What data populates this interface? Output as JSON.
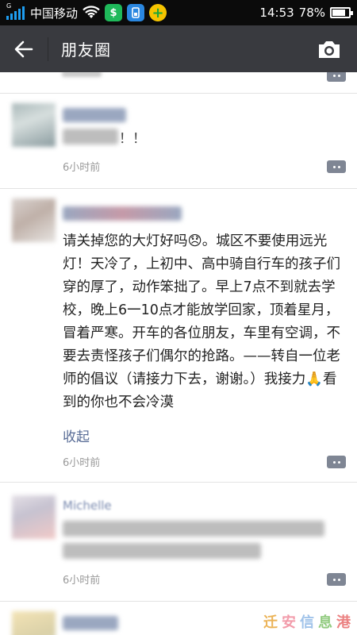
{
  "status_bar": {
    "carrier": "中国移动",
    "time": "14:53",
    "battery_percent": 78,
    "battery_label": "78%",
    "signal_type": "G"
  },
  "header": {
    "title": "朋友圈",
    "back_icon": "arrow-left-icon",
    "camera_icon": "camera-icon"
  },
  "feed": {
    "posts": [
      {
        "author": "",
        "text_suffix": "！！",
        "time": "6小时前"
      },
      {
        "author": "",
        "text": "请关掉您的大灯好吗😞。城区不要使用远光灯！天冷了，上初中、高中骑自行车的孩子们穿的厚了，动作笨拙了。早上7点不到就去学校，晚上6一10点才能放学回家，顶着星月，冒着严寒。开车的各位朋友，车里有空调，不要去责怪孩子们偶尔的抢路。——转自一位老师的倡议（请接力下去，谢谢。）我接力🙏看到的你也不会冷漠",
        "collapse_label": "收起",
        "time": "6小时前"
      },
      {
        "author": "Michelle",
        "time": "6小时前"
      }
    ]
  },
  "colors": {
    "app_bar": "#393a3f",
    "link": "#576b95",
    "timestamp": "#9a9a9a"
  }
}
